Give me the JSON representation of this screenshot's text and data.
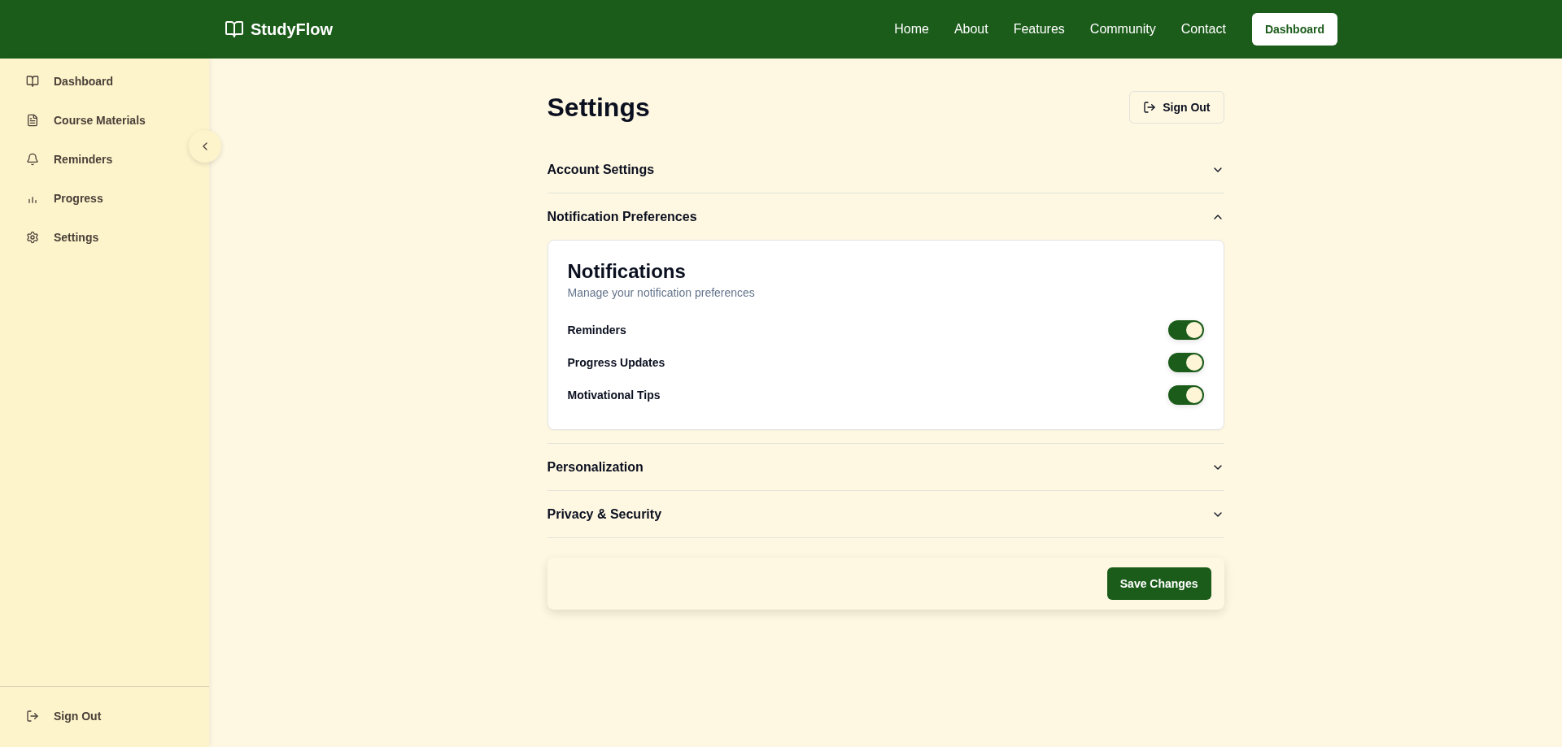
{
  "header": {
    "brand": "StudyFlow",
    "nav": [
      "Home",
      "About",
      "Features",
      "Community",
      "Contact"
    ],
    "cta": "Dashboard"
  },
  "sidebar": {
    "items": [
      {
        "label": "Dashboard"
      },
      {
        "label": "Course Materials"
      },
      {
        "label": "Reminders"
      },
      {
        "label": "Progress"
      },
      {
        "label": "Settings"
      }
    ],
    "sign_out": "Sign Out"
  },
  "page": {
    "title": "Settings",
    "sign_out": "Sign Out"
  },
  "sections": [
    {
      "title": "Account Settings",
      "expanded": false
    },
    {
      "title": "Notification Preferences",
      "expanded": true,
      "card": {
        "title": "Notifications",
        "subtitle": "Manage your notification preferences",
        "toggles": [
          {
            "label": "Reminders",
            "on": true
          },
          {
            "label": "Progress Updates",
            "on": true
          },
          {
            "label": "Motivational Tips",
            "on": true
          }
        ]
      }
    },
    {
      "title": "Personalization",
      "expanded": false
    },
    {
      "title": "Privacy & Security",
      "expanded": false
    }
  ],
  "save_button": "Save Changes"
}
